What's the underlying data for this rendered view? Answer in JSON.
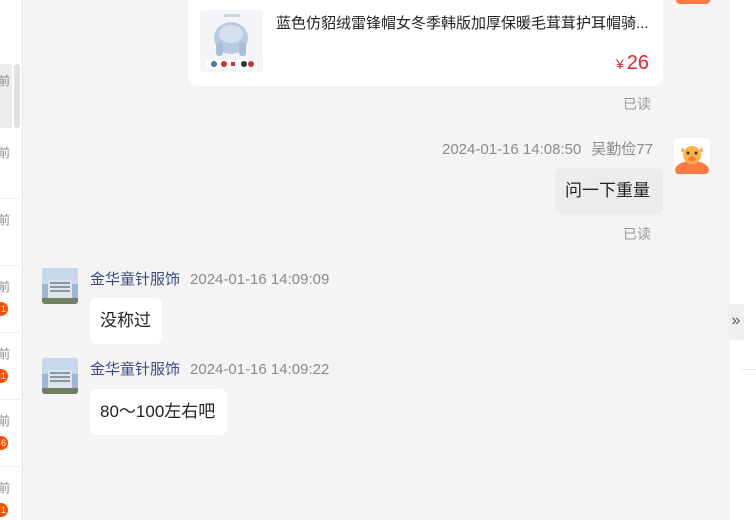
{
  "conversation_list": {
    "items": [
      {
        "time": "前",
        "badge": ""
      },
      {
        "time": "前",
        "badge": ""
      },
      {
        "time": "前",
        "badge": ""
      },
      {
        "time": "前",
        "badge": "1"
      },
      {
        "time": "前",
        "badge": "1"
      },
      {
        "time": "前",
        "badge": "6"
      },
      {
        "time": "前",
        "badge": "1"
      }
    ]
  },
  "product_card": {
    "title": "蓝色仿貂绒雷锋帽女冬季韩版加厚保暖毛茸茸护耳帽骑...",
    "currency": "¥",
    "price": "26",
    "read_status": "已读"
  },
  "messages": [
    {
      "sender": "吴勤俭77",
      "time": "2024-01-16 14:08:50",
      "text": "问一下重量",
      "read_status": "已读",
      "own": true
    },
    {
      "sender": "金华童针服饰",
      "time": "2024-01-16 14:09:09",
      "text": "没称过",
      "own": false
    },
    {
      "sender": "金华童针服饰",
      "time": "2024-01-16 14:09:22",
      "text": "80～100左右吧",
      "own": false
    }
  ],
  "colors": {
    "accent": "#ff5000",
    "price": "#e4262b",
    "sender_name": "#3a4a85",
    "background": "#f4f4f4"
  },
  "icons": {
    "collapse": "double-chevron-right-icon"
  }
}
